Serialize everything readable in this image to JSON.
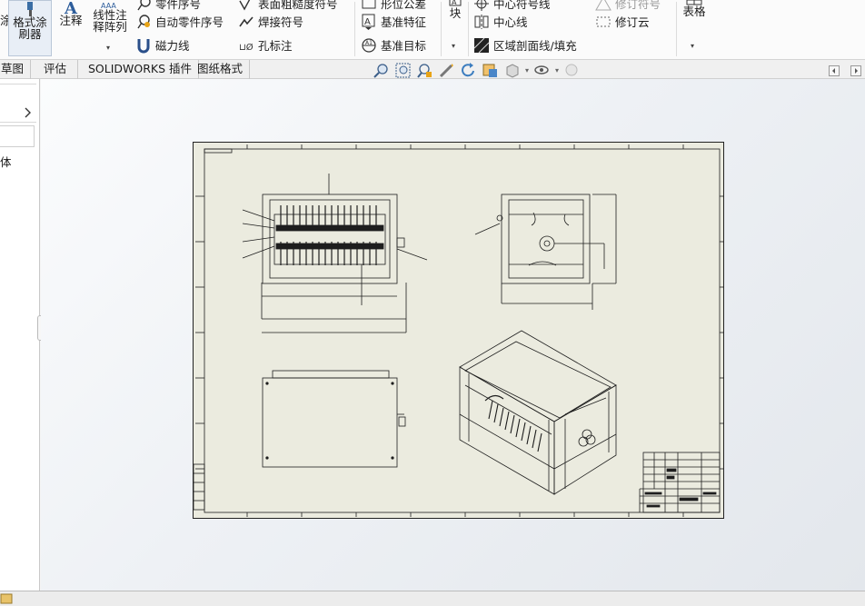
{
  "ribbon": {
    "format_painter": "格式涂\n刷器",
    "left_edge_char": "涂",
    "annotation": "注释",
    "linear_pattern": "线性注\n释阵列",
    "balloon_partial": "零件序号",
    "auto_balloon": "自动零件序号",
    "magnetic_line": "磁力线",
    "surface_finish_partial": "表面粗糙度符号",
    "weld_symbol": "焊接符号",
    "hole_callout": "孔标注",
    "datum_feature_partial": "形位公差",
    "datum_feature": "基准特征",
    "datum_target": "基准目标",
    "block": "块",
    "center_mark_partial": "中心符号线",
    "centerline": "中心线",
    "area_hatch": "区域剖面线/填充",
    "revision_symbol_partial": "修订符号",
    "revision_cloud": "修订云",
    "table": "表格"
  },
  "tabs": {
    "sketch_partial": "草图",
    "evaluate": "评估",
    "addins": "SOLIDWORKS 插件",
    "sheet_format": "图纸格式"
  },
  "leftpanel": {
    "solid_partial": "体"
  },
  "colors": {
    "sheet_bg": "#ebebdf",
    "line": "#1e1e1e",
    "canvas_top": "#fbfcfd",
    "canvas_bottom": "#e3e7ec"
  }
}
